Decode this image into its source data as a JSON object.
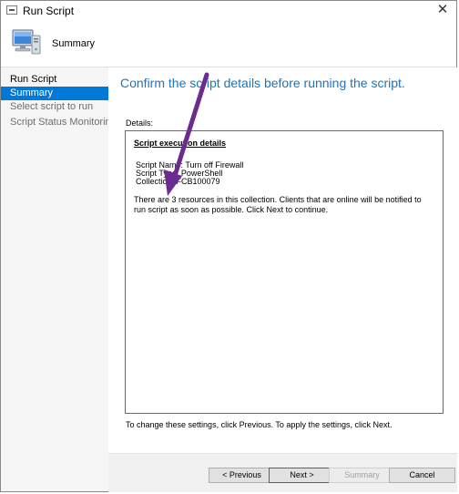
{
  "window": {
    "title": "Run Script"
  },
  "header": {
    "title": "Summary"
  },
  "sidebar": {
    "items": [
      {
        "label": "Run Script"
      },
      {
        "label": "Summary"
      },
      {
        "label": "Select script to run"
      },
      {
        "label": "Script Status Monitoring"
      }
    ]
  },
  "main": {
    "heading": "Confirm the script details before running the script.",
    "details_label": "Details:",
    "box": {
      "title": "Script execution details",
      "script_name": "Script Name: Turn off Firewall",
      "script_type": "Script Type: PowerShell",
      "collection": "Collection: FCB100079",
      "message": "There are 3 resources in this collection. Clients that are online will be notified to run script as soon as possible. Click Next to continue."
    },
    "footer_note": "To change these settings, click Previous. To apply the settings, click Next."
  },
  "buttons": {
    "previous": "< Previous",
    "next": "Next >",
    "summary": "Summary",
    "cancel": "Cancel"
  },
  "colors": {
    "accent": "#0078d7",
    "heading": "#1e73be",
    "arrow": "#6a2c91"
  }
}
